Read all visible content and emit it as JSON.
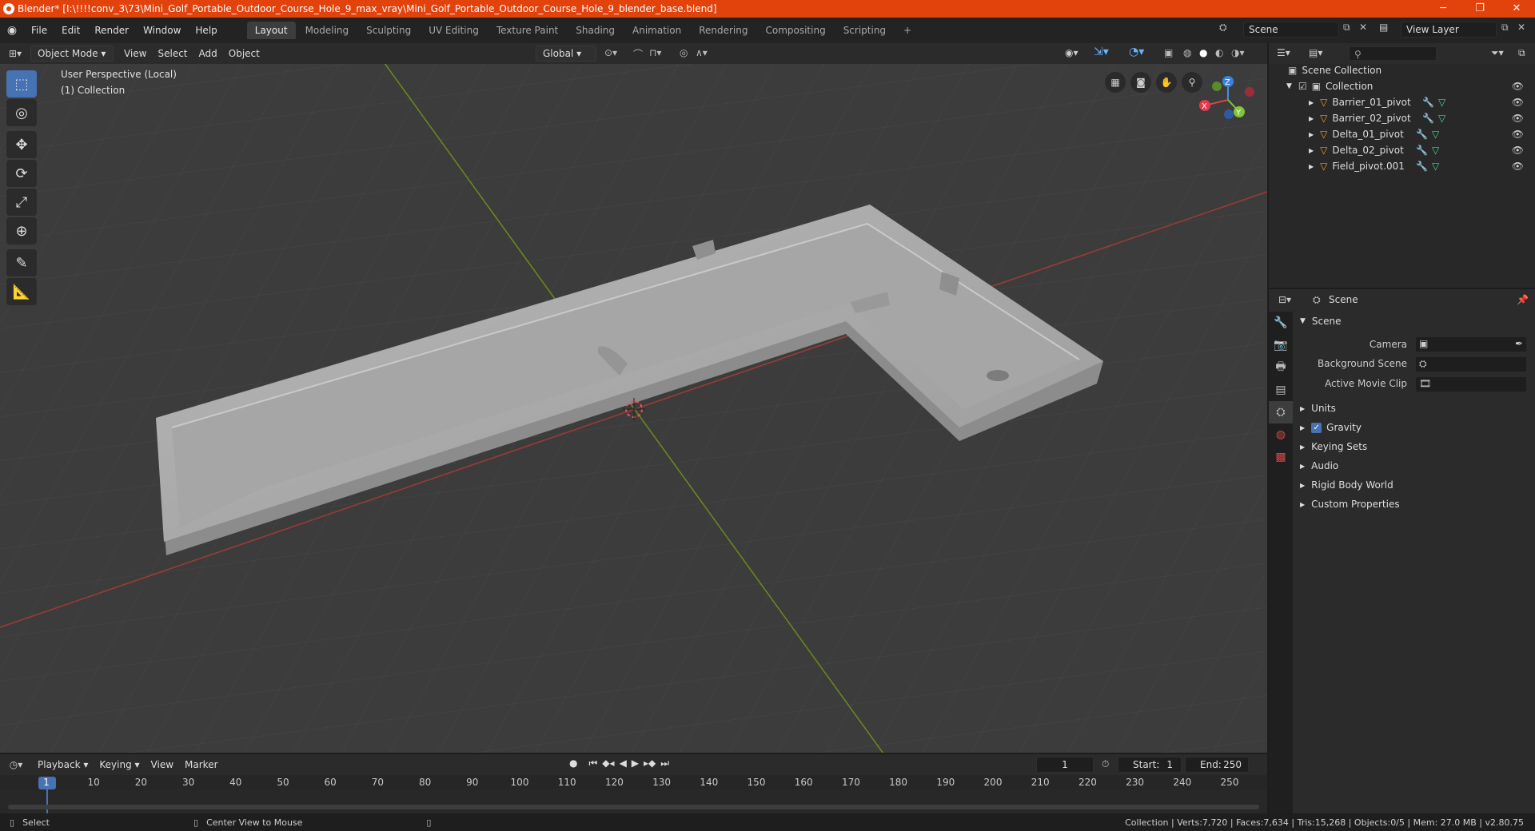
{
  "window": {
    "title": "Blender* [I:\\!!!!conv_3\\73\\Mini_Golf_Portable_Outdoor_Course_Hole_9_max_vray\\Mini_Golf_Portable_Outdoor_Course_Hole_9_blender_base.blend]",
    "minimize": "─",
    "maximize": "❐",
    "close": "✕"
  },
  "menu": {
    "items": [
      "File",
      "Edit",
      "Render",
      "Window",
      "Help"
    ]
  },
  "workspaces": {
    "tabs": [
      "Layout",
      "Modeling",
      "Sculpting",
      "UV Editing",
      "Texture Paint",
      "Shading",
      "Animation",
      "Rendering",
      "Compositing",
      "Scripting"
    ],
    "add": "+"
  },
  "scene_selector": {
    "value": "Scene"
  },
  "view_layer_selector": {
    "value": "View Layer"
  },
  "viewport_header": {
    "mode": "Object Mode",
    "menus": [
      "View",
      "Select",
      "Add",
      "Object"
    ],
    "transform_orientation": "Global"
  },
  "viewport": {
    "perspective_label": "User Perspective (Local)",
    "collection_label": "(1) Collection",
    "gizmo": {
      "x": "X",
      "y": "Y",
      "z": "Z"
    }
  },
  "outliner": {
    "root": "Scene Collection",
    "collection": "Collection",
    "objects": [
      "Barrier_01_pivot",
      "Barrier_02_pivot",
      "Delta_01_pivot",
      "Delta_02_pivot",
      "Field_pivot.001"
    ]
  },
  "properties": {
    "header": "Scene",
    "panel_title": "Scene",
    "camera_label": "Camera",
    "background_scene_label": "Background Scene",
    "active_movie_clip_label": "Active Movie Clip",
    "sections": [
      "Units",
      "Gravity",
      "Keying Sets",
      "Audio",
      "Rigid Body World",
      "Custom Properties"
    ]
  },
  "timeline": {
    "menus": [
      "Playback",
      "Keying",
      "View",
      "Marker"
    ],
    "current_frame": "1",
    "start_label": "Start:",
    "start": "1",
    "end_label": "End:",
    "end": "250",
    "ruler": [
      "1",
      "10",
      "20",
      "30",
      "40",
      "50",
      "60",
      "70",
      "80",
      "90",
      "100",
      "110",
      "120",
      "130",
      "140",
      "150",
      "160",
      "170",
      "180",
      "190",
      "200",
      "210",
      "220",
      "230",
      "240",
      "250"
    ]
  },
  "statusbar": {
    "select": "Select",
    "center_view": "Center View to Mouse",
    "stats": "Collection | Verts:7,720 | Faces:7,634 | Tris:15,268 | Objects:0/5 | Mem: 27.0 MB | v2.80.75"
  }
}
